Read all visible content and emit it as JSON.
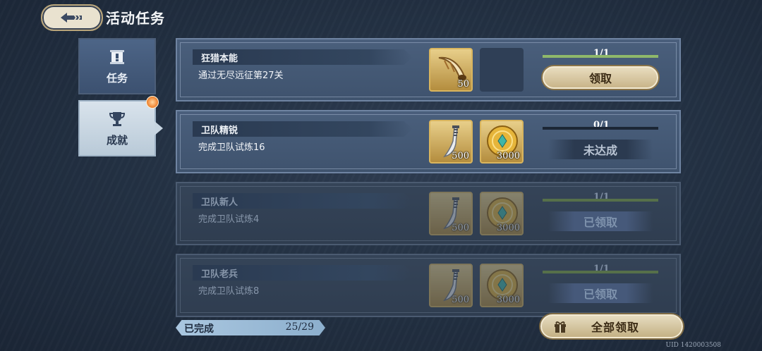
{
  "header": {
    "title": "活动任务",
    "back_icon": "back-arrow-icon"
  },
  "sidebar": {
    "tabs": [
      {
        "label": "任务",
        "icon": "scroll-icon",
        "active": false
      },
      {
        "label": "成就",
        "icon": "trophy-icon",
        "active": true,
        "badge": true
      }
    ]
  },
  "tasks": [
    {
      "name": "狂猎本能",
      "desc": "通过无尽远征第27关",
      "rewards": [
        {
          "icon": "horn-icon",
          "qty": "50"
        },
        {
          "icon": "empty-slot",
          "qty": ""
        }
      ],
      "progress": "1/1",
      "progress_ratio": 1,
      "action": "领取",
      "state": "claimable"
    },
    {
      "name": "卫队精锐",
      "desc": "完成卫队试炼16",
      "rewards": [
        {
          "icon": "dagger-icon",
          "qty": "500"
        },
        {
          "icon": "gold-coin-icon",
          "qty": "3000"
        }
      ],
      "progress": "0/1",
      "progress_ratio": 0,
      "action": "未达成",
      "state": "incomplete"
    },
    {
      "name": "卫队新人",
      "desc": "完成卫队试炼4",
      "rewards": [
        {
          "icon": "dagger-icon",
          "qty": "500"
        },
        {
          "icon": "gold-coin-icon",
          "qty": "3000"
        }
      ],
      "progress": "1/1",
      "progress_ratio": 1,
      "action": "已领取",
      "state": "claimed"
    },
    {
      "name": "卫队老兵",
      "desc": "完成卫队试炼8",
      "rewards": [
        {
          "icon": "dagger-icon",
          "qty": "500"
        },
        {
          "icon": "gold-coin-icon",
          "qty": "3000"
        }
      ],
      "progress": "1/1",
      "progress_ratio": 1,
      "action": "已领取",
      "state": "claimed"
    }
  ],
  "footer": {
    "completed_label": "已完成",
    "completed_count": "25/29",
    "claim_all_label": "全部领取",
    "claim_all_icon": "gift-icon",
    "uid": "UID 1420003508"
  },
  "colors": {
    "accent_gold": "#d9b55e",
    "progress_green": "#8fb86a",
    "card_blue": "#4a5f7c"
  }
}
